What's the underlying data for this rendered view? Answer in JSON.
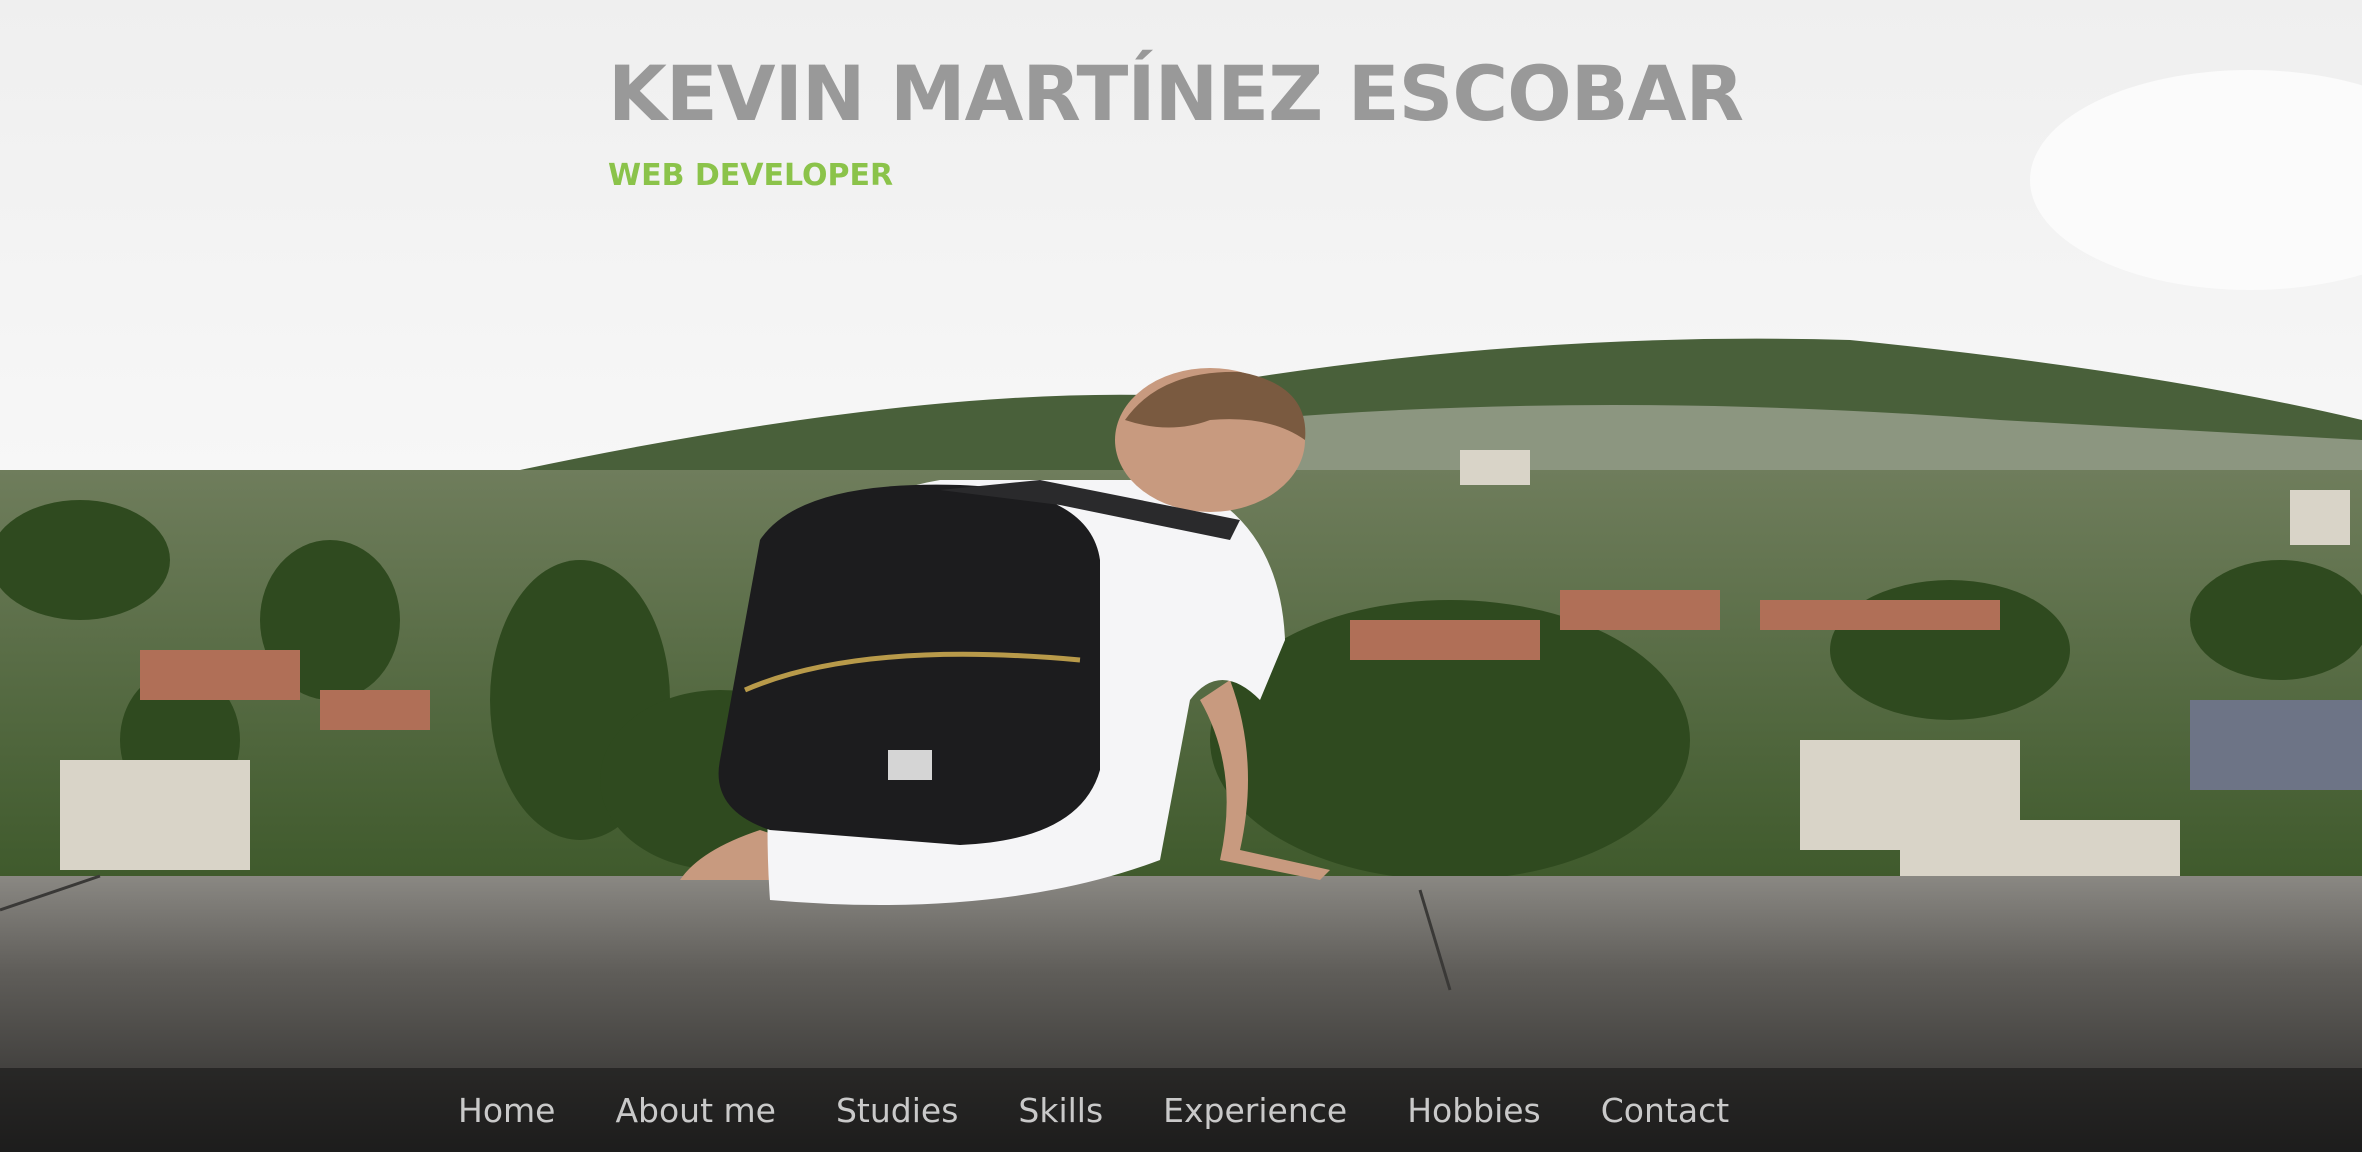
{
  "header": {
    "name": "KEVIN MARTÍNEZ ESCOBAR",
    "role": "WEB DEVELOPER"
  },
  "nav": {
    "items": [
      "Home",
      "About me",
      "Studies",
      "Skills",
      "Experience",
      "Hobbies",
      "Contact"
    ]
  },
  "colors": {
    "name_text": "#999999",
    "role_text": "#8bc34a",
    "nav_text": "#c9c9c9"
  }
}
